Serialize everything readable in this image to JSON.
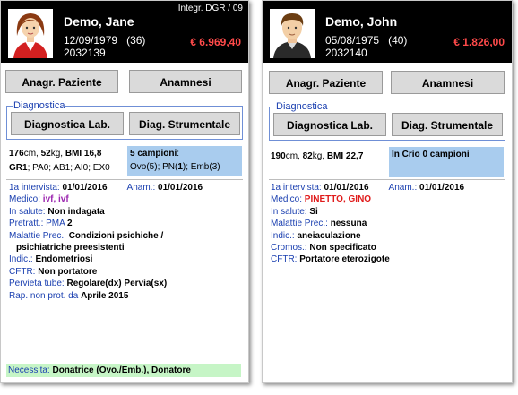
{
  "patients": [
    {
      "name": "Demo, Jane",
      "dob": "12/09/1979",
      "age": "(36)",
      "id": "2032139",
      "amount": "€ 6.969,40",
      "integration": "Integr. DGR / 09",
      "avatar": "female-avatar",
      "buttons": {
        "anagr": "Anagr. Paziente",
        "anamnesi": "Anamnesi",
        "lab": "Diagnostica Lab.",
        "strum": "Diag. Strumentale"
      },
      "diag_legend": "Diagnostica",
      "stats": {
        "height": "176",
        "weight": "52",
        "bmi": "BMI 16,8",
        "gr": "1",
        "pa": "0",
        "ab": "1",
        "ai": "0",
        "ex": "0"
      },
      "samples": {
        "title": "5 campioni",
        "ovo": "5",
        "pn": "1",
        "emb": "3"
      },
      "intervista_label": "1a intervista:",
      "intervista": "01/01/2016",
      "anam_label": "Anam.:",
      "anam": "01/01/2016",
      "rows": [
        {
          "label": "Medico:",
          "value": "ivf, ivf"
        },
        {
          "label": "In salute:",
          "value": "Non indagata"
        },
        {
          "label": "Pretratt.:",
          "value": "PMA",
          "extra": "2"
        },
        {
          "label": "Malattie Prec.:",
          "value": "Condizioni psichiche /"
        },
        {
          "label": "",
          "value": "psichiatriche preesistenti"
        },
        {
          "label": "Indic.:",
          "value": "Endometriosi"
        },
        {
          "label": "CFTR:",
          "value": "Non portatore"
        },
        {
          "label": "Pervieta tube:",
          "value": "Regolare(dx) Pervia(sx)"
        },
        {
          "label": "Rap. non prot. da",
          "value": "Aprile 2015"
        }
      ],
      "needs_label": "Necessita:",
      "needs": "Donatrice (Ovo./Emb.), Donatore"
    },
    {
      "name": "Demo, John",
      "dob": "05/08/1975",
      "age": "(40)",
      "id": "2032140",
      "amount": "€ 1.826,00",
      "avatar": "male-avatar",
      "buttons": {
        "anagr": "Anagr. Paziente",
        "anamnesi": "Anamnesi",
        "lab": "Diagnostica Lab.",
        "strum": "Diag. Strumentale"
      },
      "diag_legend": "Diagnostica",
      "stats": {
        "height": "190",
        "weight": "82",
        "bmi": "BMI 22,7"
      },
      "samples": {
        "title": "In Crio 0 campioni"
      },
      "intervista_label": "1a intervista:",
      "intervista": "01/01/2016",
      "anam_label": "Anam.:",
      "anam": "01/01/2016",
      "rows": [
        {
          "label": "Medico:",
          "value": "PINETTO, GINO"
        },
        {
          "label": "In salute:",
          "value": "Si"
        },
        {
          "label": "Malattie Prec.:",
          "value": "nessuna"
        },
        {
          "label": "Indic.:",
          "value": "aneiaculazione"
        },
        {
          "label": "Cromos.:",
          "value": "Non specificato"
        },
        {
          "label": "CFTR:",
          "value": "Portatore eterozigote"
        }
      ]
    }
  ],
  "colors": {
    "header_bg": "#000000",
    "amount": "#ff4a4a",
    "label_blue": "#1a3fb0",
    "samples_bg": "#a9ccee",
    "needs_bg": "#c6f5c6",
    "medico_female": "#9c27b0",
    "medico_male": "#e01b1b"
  }
}
